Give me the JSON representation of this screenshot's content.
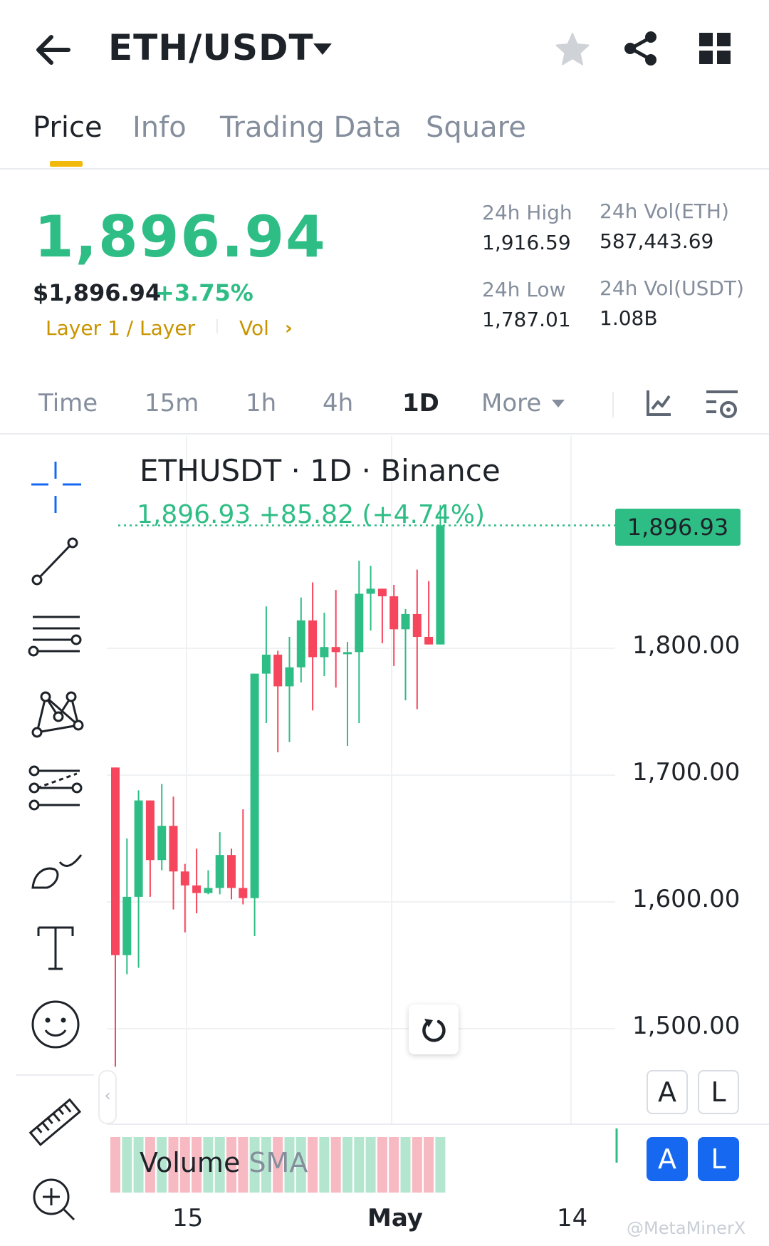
{
  "header": {
    "pair": "ETH/USDT",
    "icons": [
      "back-arrow-icon",
      "caret-down-icon",
      "star-icon",
      "share-icon",
      "grid-icon"
    ]
  },
  "tabs": [
    {
      "label": "Price",
      "active": true
    },
    {
      "label": "Info",
      "active": false
    },
    {
      "label": "Trading Data",
      "active": false
    },
    {
      "label": "Square",
      "active": false
    }
  ],
  "price": {
    "last": "1,896.94",
    "usd": "$1,896.94",
    "change": "+3.75%",
    "tag_layer": "Layer 1 / Layer",
    "tag_vol": "Vol",
    "colors": {
      "up": "#2ebd85",
      "down": "#f6465d",
      "accent": "#f0b90b",
      "tag": "#c99400"
    }
  },
  "stats": {
    "high_label": "24h High",
    "high_value": "1,916.59",
    "vol_eth_label": "24h Vol(ETH)",
    "vol_eth_value": "587,443.69",
    "low_label": "24h Low",
    "low_value": "1,787.01",
    "vol_usdt_label": "24h Vol(USDT)",
    "vol_usdt_value": "1.08B"
  },
  "intervals": {
    "items": [
      "Time",
      "15m",
      "1h",
      "4h",
      "1D",
      "More"
    ],
    "active": "1D"
  },
  "toolbar": {
    "tools": [
      "crosshair-icon",
      "trend-line-icon",
      "horizontal-lines-icon",
      "pattern-icon",
      "fib-icon",
      "brush-icon",
      "text-icon",
      "emoji-icon",
      "ruler-icon",
      "zoom-in-icon"
    ]
  },
  "chart": {
    "title": "ETHUSDT · 1D · Binance",
    "readout": "1,896.93  +85.82 (+4.74%)",
    "price_tag": "1,896.93",
    "y_labels": [
      "1,800.00",
      "1,700.00",
      "1,600.00",
      "1,500.00"
    ],
    "x_labels": [
      "15",
      "May",
      "14"
    ],
    "volume_label": "Volume",
    "volume_sma": "SMA",
    "btn_a": "A",
    "btn_l": "L",
    "collapse": "‹",
    "watermark": "@MetaMinerX"
  },
  "chart_data": {
    "type": "candlestick",
    "title": "ETHUSDT · 1D · Binance",
    "interval": "1D",
    "ylim": [
      1470,
      1920
    ],
    "y_ticks": [
      1500,
      1600,
      1700,
      1800
    ],
    "last_price": 1896.93,
    "grid": true,
    "candles": [
      {
        "o": 1706,
        "h": 1706,
        "l": 1470,
        "c": 1558
      },
      {
        "o": 1558,
        "h": 1650,
        "l": 1543,
        "c": 1604
      },
      {
        "o": 1604,
        "h": 1688,
        "l": 1548,
        "c": 1680
      },
      {
        "o": 1680,
        "h": 1648,
        "l": 1604,
        "c": 1633
      },
      {
        "o": 1633,
        "h": 1693,
        "l": 1625,
        "c": 1660
      },
      {
        "o": 1660,
        "h": 1683,
        "l": 1594,
        "c": 1624
      },
      {
        "o": 1624,
        "h": 1630,
        "l": 1576,
        "c": 1613
      },
      {
        "o": 1613,
        "h": 1642,
        "l": 1591,
        "c": 1607
      },
      {
        "o": 1607,
        "h": 1625,
        "l": 1606,
        "c": 1611
      },
      {
        "o": 1611,
        "h": 1655,
        "l": 1606,
        "c": 1637
      },
      {
        "o": 1637,
        "h": 1642,
        "l": 1602,
        "c": 1611
      },
      {
        "o": 1611,
        "h": 1673,
        "l": 1598,
        "c": 1603
      },
      {
        "o": 1603,
        "h": 1771,
        "l": 1573,
        "c": 1780
      },
      {
        "o": 1780,
        "h": 1833,
        "l": 1741,
        "c": 1795
      },
      {
        "o": 1795,
        "h": 1798,
        "l": 1718,
        "c": 1770
      },
      {
        "o": 1770,
        "h": 1809,
        "l": 1726,
        "c": 1785
      },
      {
        "o": 1785,
        "h": 1840,
        "l": 1773,
        "c": 1822
      },
      {
        "o": 1822,
        "h": 1852,
        "l": 1751,
        "c": 1793
      },
      {
        "o": 1793,
        "h": 1828,
        "l": 1778,
        "c": 1801
      },
      {
        "o": 1801,
        "h": 1846,
        "l": 1769,
        "c": 1797
      },
      {
        "o": 1797,
        "h": 1805,
        "l": 1723,
        "c": 1797
      },
      {
        "o": 1797,
        "h": 1869,
        "l": 1741,
        "c": 1843
      },
      {
        "o": 1843,
        "h": 1865,
        "l": 1814,
        "c": 1847
      },
      {
        "o": 1847,
        "h": 1839,
        "l": 1804,
        "c": 1841
      },
      {
        "o": 1841,
        "h": 1850,
        "l": 1786,
        "c": 1815
      },
      {
        "o": 1815,
        "h": 1831,
        "l": 1759,
        "c": 1827
      },
      {
        "o": 1827,
        "h": 1862,
        "l": 1752,
        "c": 1809
      },
      {
        "o": 1809,
        "h": 1853,
        "l": 1805,
        "c": 1803
      },
      {
        "o": 1803,
        "h": 1913,
        "l": 1808,
        "c": 1897
      }
    ]
  }
}
